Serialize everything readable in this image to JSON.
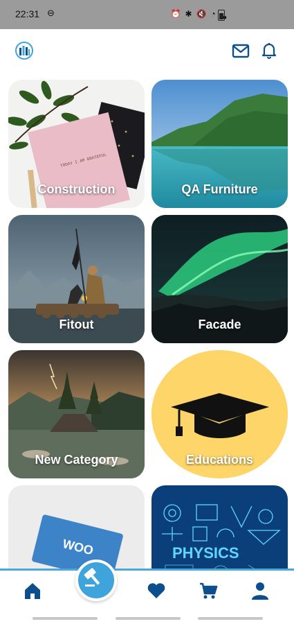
{
  "status_bar": {
    "time": "22:31",
    "icons": [
      "dnd-icon",
      "alarm-icon",
      "bluetooth-icon",
      "mute-icon",
      "wifi-icon",
      "signal-icon",
      "battery-icon"
    ]
  },
  "header": {
    "logo": "building-logo-icon",
    "actions": [
      "mail-icon",
      "bell-icon"
    ],
    "accent_color": "#0d4f8c"
  },
  "categories": [
    {
      "label": "Construction"
    },
    {
      "label": "QA Furniture"
    },
    {
      "label": "Fitout"
    },
    {
      "label": "Facade"
    },
    {
      "label": "New Category"
    },
    {
      "label": "Educations"
    },
    {
      "label": ""
    },
    {
      "label": ""
    }
  ],
  "image_text": {
    "notebook": "TODAY I AM GRATEFUL",
    "woo": "WOO",
    "physics": "PHYSICS"
  },
  "bottom_nav": {
    "items": [
      "home-icon",
      "auction-hammer-icon",
      "heart-icon",
      "cart-icon",
      "profile-icon"
    ],
    "active": "home-icon",
    "accent_color": "#3fa4dc"
  }
}
